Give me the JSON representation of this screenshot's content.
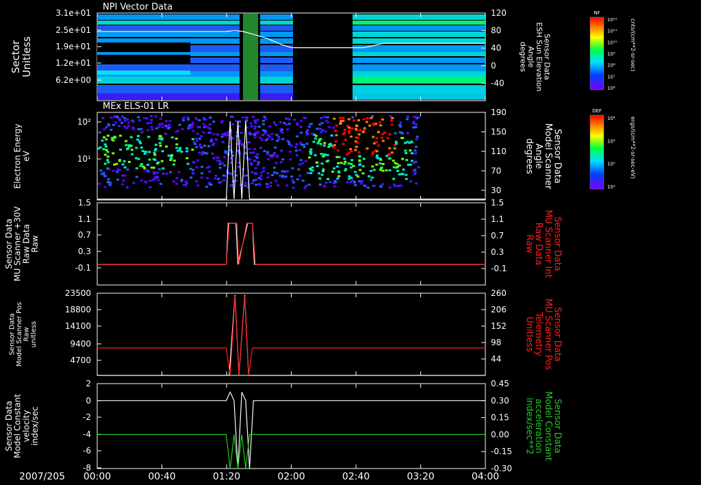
{
  "date_label": "2007/205",
  "time_ticks": [
    "00:00",
    "00:40",
    "01:20",
    "02:00",
    "02:40",
    "03:20",
    "04:00"
  ],
  "colors": {
    "white": "#ffffff",
    "red": "#ff2020",
    "green": "#22cc22",
    "background": "#000000"
  },
  "colorbars": [
    {
      "title": "NF",
      "units": "cnts/(cm**2-sr-sec)",
      "ticks": [
        "10¹²",
        "10¹¹",
        "10¹⁰",
        "10⁹",
        "10⁸",
        "10⁷",
        "10⁶"
      ]
    },
    {
      "title": "DEF",
      "units": "ergs/(cm**2-sr-sec-eV)",
      "ticks": [
        "10⁴",
        "10³",
        "10²",
        "10¹"
      ]
    }
  ],
  "chart_data": [
    {
      "type": "heatmap",
      "panel_title": "NPI Vector Data",
      "ylabel": "Sector\nUnitless",
      "y_ticks": [
        "3.1e+01",
        "2.5e+01",
        "1.9e+01",
        "1.2e+01",
        "6.2e+00"
      ],
      "right_ylabel": "Sensor Data\nESH Sun Elevation\nAngle\ndegrees",
      "right_ticks": [
        "120",
        "80",
        "40",
        "0",
        "-40"
      ],
      "right_range": [
        -80,
        120
      ],
      "overlay_series": [
        {
          "color": "white",
          "x_hours": [
            0.0,
            1.33,
            1.42,
            1.5,
            1.6,
            1.75,
            1.9,
            2.0,
            2.5,
            2.75,
            2.95,
            4.0
          ],
          "values": [
            78,
            78,
            80,
            78,
            72,
            62,
            48,
            41,
            41,
            41,
            51,
            51
          ]
        }
      ]
    },
    {
      "type": "heatmap",
      "panel_title": "MEx ELS-01 LR",
      "ylabel": "Electron Energy\neV",
      "y_ticks": [
        "10²",
        "10¹"
      ],
      "right_ylabel": "Sensor Data\nModel Scanner\nAngle\ndegrees",
      "right_ticks": [
        "190",
        "150",
        "110",
        "70",
        "30"
      ],
      "right_range": [
        10,
        190
      ],
      "overlay_series": [
        {
          "color": "white",
          "x_hours": [
            0.0,
            1.33,
            1.37,
            1.41,
            1.45,
            1.49,
            1.53,
            1.57,
            1.61,
            4.0
          ],
          "values": [
            12,
            12,
            172,
            12,
            172,
            12,
            172,
            12,
            12,
            12
          ]
        }
      ]
    },
    {
      "type": "line",
      "ylabel": "Sensor Data\nMU Scanner +30V\nRaw Data\nRaw",
      "y_ticks": [
        "1.5",
        "1.1",
        "0.7",
        "0.3",
        "-0.1"
      ],
      "y_range": [
        -0.5,
        1.5
      ],
      "right_ylabel": "Sensor Data\nMU Scanner Int\nRaw Data\nRaw",
      "right_ticks": [
        "1.5",
        "1.1",
        "0.7",
        "0.3",
        "-0.1"
      ],
      "right_range": [
        -0.5,
        1.5
      ],
      "series": [
        {
          "axis": "left",
          "color": "white",
          "x_hours": [
            0.0,
            1.33,
            1.35,
            1.43,
            1.45,
            1.55,
            1.57,
            1.6,
            1.62,
            4.0
          ],
          "values": [
            0,
            0,
            1,
            1,
            0,
            1,
            1,
            1,
            0,
            0
          ]
        },
        {
          "axis": "right",
          "color": "red",
          "x_hours": [
            0.0,
            1.33,
            1.36,
            1.44,
            1.46,
            1.54,
            1.56,
            1.6,
            1.63,
            4.0
          ],
          "values": [
            0,
            0,
            1,
            1,
            0,
            1,
            1,
            1,
            0,
            0
          ]
        }
      ]
    },
    {
      "type": "line",
      "ylabel": "Sensor Data\nModel Scanner Pos\nRaw\nunitless",
      "y_ticks": [
        "23500",
        "18800",
        "14100",
        "9400",
        "4700"
      ],
      "y_range": [
        0,
        23500
      ],
      "right_ylabel": "Sensor Data\nMU Scanner Pos\nTelemetry\nUnitless",
      "right_ticks": [
        "260",
        "206",
        "152",
        "98",
        "44"
      ],
      "right_range": [
        -10,
        260
      ],
      "series": [
        {
          "axis": "left",
          "color": "white",
          "x_hours": [
            0.0,
            1.33,
            1.36,
            1.42,
            1.46,
            1.52,
            1.56,
            1.6,
            4.0
          ],
          "values": [
            0,
            0,
            0,
            23000,
            0,
            23000,
            0,
            0,
            0
          ]
        },
        {
          "axis": "right",
          "color": "red",
          "x_hours": [
            0.0,
            1.33,
            1.37,
            1.42,
            1.46,
            1.52,
            1.56,
            1.6,
            4.0
          ],
          "values": [
            80,
            80,
            -10,
            250,
            -10,
            250,
            -10,
            80,
            80
          ]
        }
      ]
    },
    {
      "type": "line",
      "ylabel": "Sensor Data\nModel Constant\nvelocity\nindex/sec",
      "y_ticks": [
        "2",
        "0",
        "-2",
        "-4",
        "-6",
        "-8"
      ],
      "y_range": [
        -8,
        2
      ],
      "right_ylabel": "Sensor Data\nModel Constant\nacceleration\nindex/sec**2",
      "right_ticks": [
        "0.45",
        "0.30",
        "0.15",
        "0.00",
        "-0.15",
        "-0.30"
      ],
      "right_range": [
        -0.3,
        0.45
      ],
      "series": [
        {
          "axis": "left",
          "color": "white",
          "x_hours": [
            0.0,
            1.33,
            1.37,
            1.41,
            1.45,
            1.49,
            1.53,
            1.57,
            1.61,
            4.0
          ],
          "values": [
            0,
            0,
            1,
            0,
            -8,
            1,
            0,
            -8,
            0,
            0
          ]
        },
        {
          "axis": "right",
          "color": "green",
          "x_hours": [
            0.0,
            1.33,
            1.37,
            1.41,
            1.45,
            1.49,
            1.53,
            1.57,
            1.61,
            4.0
          ],
          "values": [
            0,
            0,
            -0.3,
            0,
            -0.3,
            0.0,
            -0.3,
            0,
            0,
            0
          ]
        }
      ]
    }
  ]
}
